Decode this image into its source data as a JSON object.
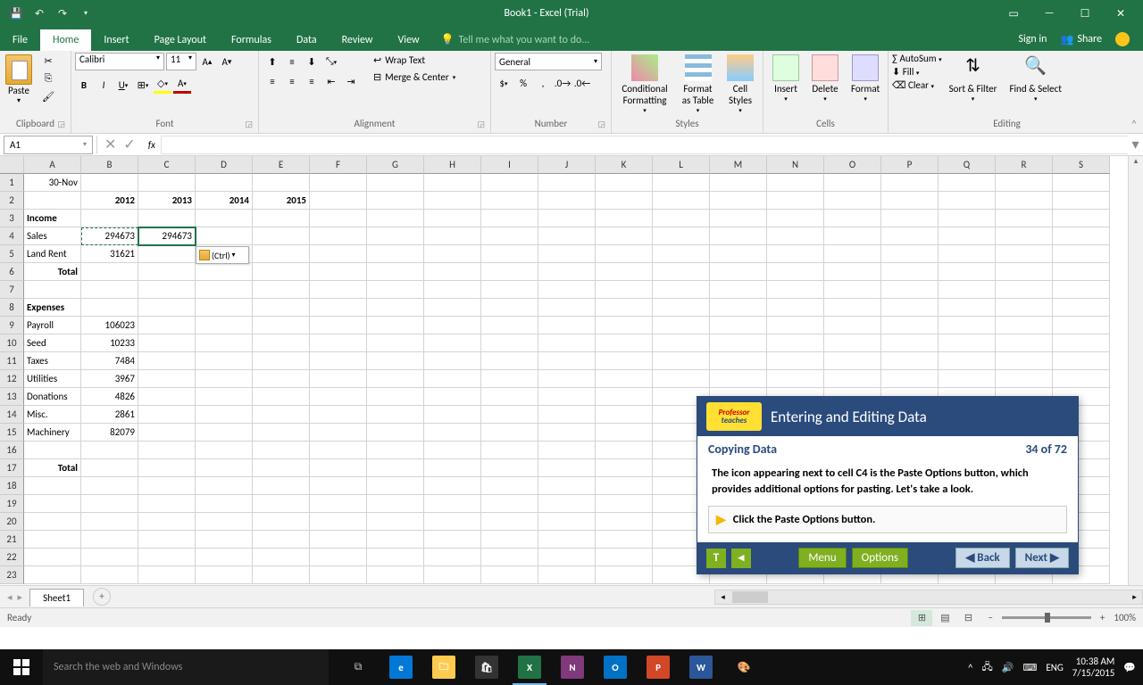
{
  "title": "Book1 - Excel (Trial)",
  "menu": {
    "file": "File",
    "home": "Home",
    "insert": "Insert",
    "pageLayout": "Page Layout",
    "formulas": "Formulas",
    "data": "Data",
    "review": "Review",
    "view": "View",
    "tellme": "Tell me what you want to do...",
    "signin": "Sign in",
    "share": "Share"
  },
  "ribbon": {
    "clipboard": {
      "paste": "Paste",
      "label": "Clipboard"
    },
    "font": {
      "name": "Calibri",
      "size": "11",
      "label": "Font"
    },
    "alignment": {
      "wrap": "Wrap Text",
      "merge": "Merge & Center",
      "label": "Alignment"
    },
    "number": {
      "format": "General",
      "label": "Number"
    },
    "styles": {
      "cond": "Conditional Formatting",
      "table": "Format as Table",
      "cell": "Cell Styles",
      "label": "Styles"
    },
    "cells": {
      "insert": "Insert",
      "delete": "Delete",
      "format": "Format",
      "label": "Cells"
    },
    "editing": {
      "autosum": "AutoSum",
      "fill": "Fill",
      "clear": "Clear",
      "sort": "Sort & Filter",
      "find": "Find & Select",
      "label": "Editing"
    }
  },
  "nameBox": "A1",
  "columns": [
    "A",
    "B",
    "C",
    "D",
    "E",
    "F",
    "G",
    "H",
    "I",
    "J",
    "K",
    "L",
    "M",
    "N",
    "O",
    "P",
    "Q",
    "R",
    "S"
  ],
  "rows": [
    "1",
    "2",
    "3",
    "4",
    "5",
    "6",
    "7",
    "8",
    "9",
    "10",
    "11",
    "12",
    "13",
    "14",
    "15",
    "16",
    "17",
    "18",
    "19",
    "20",
    "21",
    "22",
    "23"
  ],
  "cells": {
    "A1": "30-Nov",
    "B2": "2012",
    "C2": "2013",
    "D2": "2014",
    "E2": "2015",
    "A3": "Income",
    "A4": "Sales",
    "B4": "294673",
    "C4": "294673",
    "A5": "Land Rent",
    "B5": "31621",
    "A6": "Total",
    "A8": "Expenses",
    "A9": "Payroll",
    "B9": "106023",
    "A10": "Seed",
    "B10": "10233",
    "A11": "Taxes",
    "B11": "7484",
    "A12": "Utilities",
    "B12": "3967",
    "A13": "Donations",
    "B13": "4826",
    "A14": "Misc.",
    "B14": "2861",
    "A15": "Machinery",
    "B15": "82079",
    "A17": "Total"
  },
  "pasteOptions": "(Ctrl)",
  "sheet": {
    "name": "Sheet1"
  },
  "status": {
    "ready": "Ready",
    "zoom": "100%"
  },
  "tutor": {
    "title": "Entering and Editing Data",
    "subtitle": "Copying Data",
    "progress": "34 of 72",
    "body": "The icon appearing next to cell C4 is the Paste Options button, which provides additional options for pasting. Let's take a look.",
    "action": "Click the Paste Options button.",
    "menu": "Menu",
    "options": "Options",
    "back": "Back",
    "next": "Next",
    "t": "T"
  },
  "taskbar": {
    "search": "Search the web and Windows",
    "lang": "ENG",
    "time": "10:38 AM",
    "date": "7/15/2015"
  }
}
